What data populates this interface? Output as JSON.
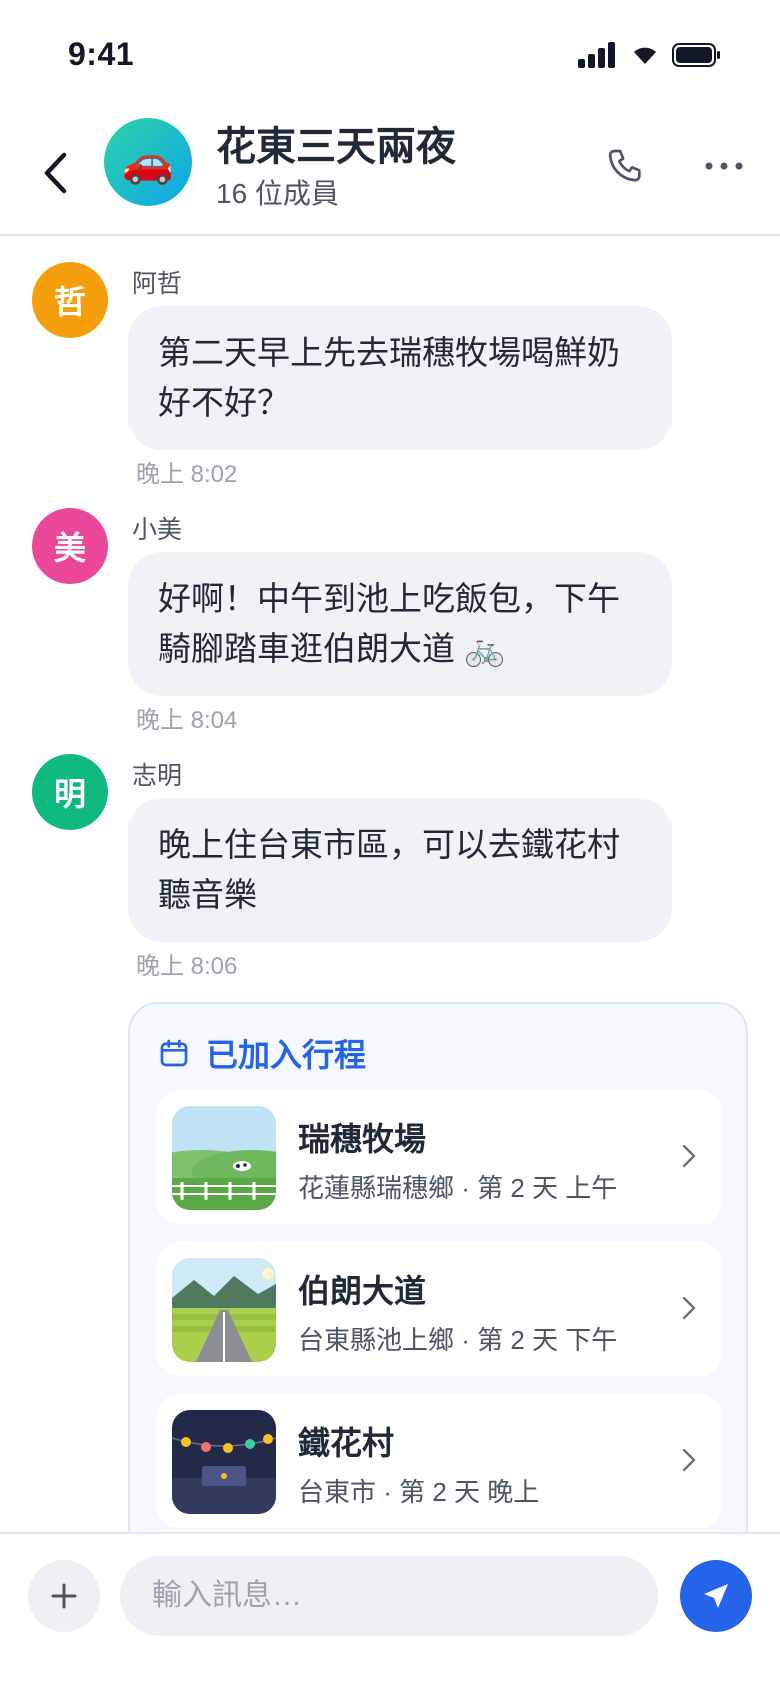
{
  "status_bar": {
    "time": "9:41"
  },
  "header": {
    "avatar_emoji": "🚗",
    "title": "花東三天兩夜",
    "subtitle": "16 位成員",
    "icons": [
      "back-arrow-icon",
      "phone-icon",
      "more-dots-icon"
    ]
  },
  "messages": [
    {
      "avatar_char": "哲",
      "avatar_color": "#f59e0b",
      "sender": "阿哲",
      "text": "第二天早上先去瑞穗牧場喝鮮奶好不好？",
      "time": "晚上 8:02"
    },
    {
      "avatar_char": "美",
      "avatar_color": "#ec4899",
      "sender": "小美",
      "text": "好啊！中午到池上吃飯包，下午騎腳踏車逛伯朗大道 🚲",
      "time": "晚上 8:04"
    },
    {
      "avatar_char": "明",
      "avatar_color": "#10b981",
      "sender": "志明",
      "text": "晚上住台東市區，可以去鐵花村聽音樂",
      "time": "晚上 8:06"
    }
  ],
  "itinerary": {
    "title": "已加入行程",
    "items": [
      {
        "name": "瑞穗牧場",
        "meta": "花蓮縣瑞穗鄉 · 第 2 天 上午",
        "thumb": "pasture"
      },
      {
        "name": "伯朗大道",
        "meta": "台東縣池上鄉 · 第 2 天 下午",
        "thumb": "road"
      },
      {
        "name": "鐵花村",
        "meta": "台東市 · 第 2 天 晚上",
        "thumb": "night-village"
      }
    ]
  },
  "composer": {
    "placeholder": "輸入訊息…"
  },
  "colors": {
    "accent": "#2563eb",
    "bubble": "#f1f2f5"
  }
}
